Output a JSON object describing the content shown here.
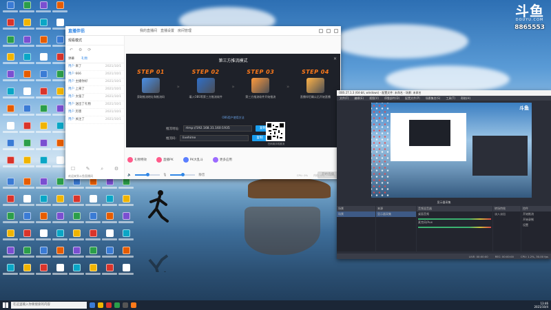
{
  "overlay": {
    "logo": "斗鱼",
    "site": "DOUYU.COM",
    "room_number": "8865553"
  },
  "live_window": {
    "brand": "直播伴侣",
    "room_tag": "",
    "top_info": [
      "我的直播间",
      "直播设置",
      "房间管理"
    ],
    "left": {
      "section_title": "观看模式",
      "tabs": [
        "弹幕",
        "礼物"
      ],
      "messages": [
        {
          "who": "用户",
          "text": "来了",
          "time": "2021/10/1"
        },
        {
          "who": "用户",
          "text": "666",
          "time": "2021/10/1"
        },
        {
          "who": "用户",
          "text": "主播你好",
          "time": "2021/10/1"
        },
        {
          "who": "用户",
          "text": "上来了",
          "time": "2021/10/1"
        },
        {
          "who": "用户",
          "text": "太强了",
          "time": "2021/10/1"
        },
        {
          "who": "用户",
          "text": "送出了礼物",
          "time": "2021/10/1"
        },
        {
          "who": "用户",
          "text": "厉害",
          "time": "2021/10/1"
        },
        {
          "who": "用户",
          "text": "关注了",
          "time": "2021/10/1"
        }
      ],
      "notice": "欢迎来到斗鱼直播间"
    },
    "third_party": {
      "title": "第三方推流模式",
      "steps": [
        {
          "label": "STEP 01",
          "text": "获取推流地址和推流码",
          "color": "#4a8fe7"
        },
        {
          "label": "STEP 02",
          "text": "填入OBS等第三方推流软件",
          "color": "#2f6fc9"
        },
        {
          "label": "STEP 03",
          "text": "第三方推流软件开始推流",
          "color": "#ff9a3c"
        },
        {
          "label": "STEP 04",
          "text": "直播伴侣确认后开始直播",
          "color": "#ffb347"
        }
      ],
      "help": "OBS用户使用方法",
      "rtmp_label": "推流地址:",
      "rtmp_value": "rtmp://192.168.31.160:1935",
      "key_label": "推流码:",
      "key_value": "livehime",
      "copy": "复制",
      "qr_caption": "扫码用手机推流"
    },
    "tools": [
      "礼物特效",
      "直播PK",
      "PK大乱斗",
      "更多应用"
    ],
    "tool_colors": [
      "#ff5a8a",
      "#ff5a8a",
      "#5b7fff",
      "#9c6bff"
    ],
    "volume": {
      "speaker_pct": 0.5,
      "mic_pct": 0.5,
      "mute_label": "静音"
    },
    "start_button": "开始直播",
    "status": [
      "CPU: 0%",
      "内存: 0%",
      "FPS: 0"
    ]
  },
  "obs": {
    "title": "OBS 27.1.3 (64-bit, windows) - 配置文件: 未命名 - 场景: 未命名",
    "menu": [
      "文件(F)",
      "编辑(E)",
      "视图(V)",
      "停靠部件(D)",
      "配置文件(P)",
      "场景集合(S)",
      "工具(T)",
      "帮助(H)"
    ],
    "controls": "显示器采集",
    "docks": {
      "scenes": "场景",
      "scene_item": "场景",
      "sources": "来源",
      "source_item": "显示器采集",
      "mixer": "音频混音器",
      "mixer_items": [
        "桌面音频",
        "麦克风/Aux"
      ],
      "transitions": "转场特效",
      "transition_value": "淡入淡出",
      "controls": "控件",
      "buttons": [
        "开始推流",
        "开始录制",
        "设置"
      ]
    },
    "status": [
      "LIVE: 00:00:00",
      "REC: 00:00:00",
      "CPU: 1.2%, 30.00 fps"
    ]
  },
  "taskbar": {
    "search": "在这里输入你要搜索的内容",
    "time": "13:46",
    "date": "2021/10/4"
  }
}
